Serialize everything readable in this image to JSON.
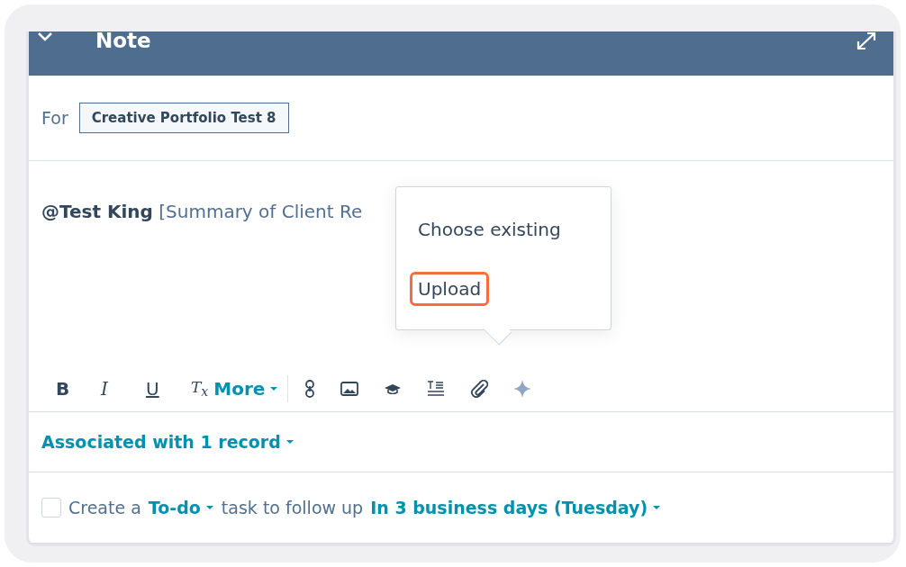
{
  "header": {
    "title": "Note"
  },
  "for_row": {
    "label": "For",
    "record": "Creative Portfolio Test 8"
  },
  "editor": {
    "body": "**@Test King** [Summary of Client Re"
  },
  "toolbar": [
    {
      "kind": "bold",
      "label": "B"
    },
    {
      "kind": "italic",
      "label": "I"
    },
    {
      "kind": "underline",
      "label": "U"
    },
    {
      "kind": "clear",
      "label": "T$_{x}$"
    },
    {
      "kind": "dropdown",
      "label": "More"
    }
  ],
  "attach_menu": {
    "items": [
      {
        "label": "Choose existing",
        "highlighted": false
      },
      {
        "label": "Upload",
        "highlighted": true
      }
    ]
  },
  "associations": {
    "label": "Associated with 1 record"
  },
  "follow_up": {
    "checked": false,
    "prefix": "Create a",
    "task_type": "To-do",
    "middle": "task to follow up",
    "due": "In 3 business days (Tuesday)"
  }
}
